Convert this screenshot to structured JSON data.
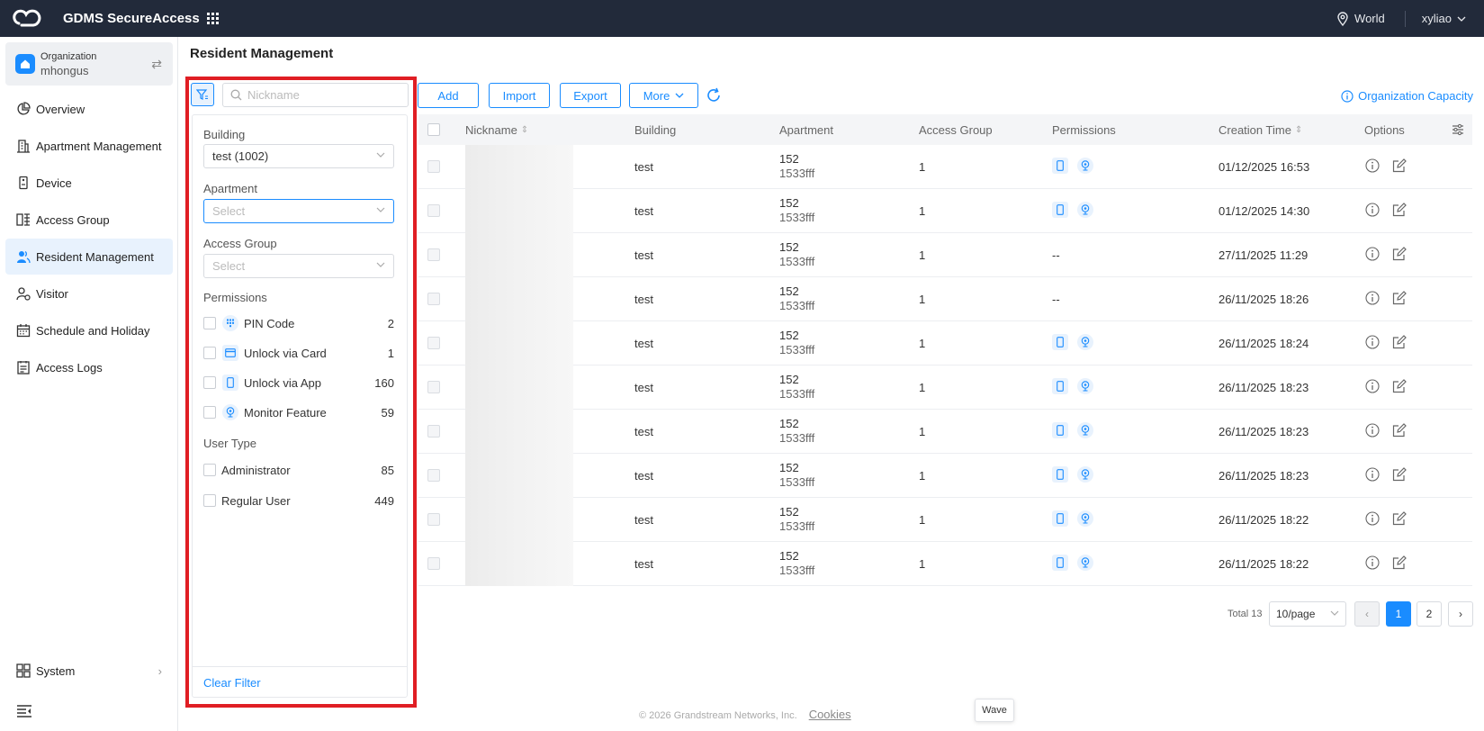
{
  "topbar": {
    "app_title": "GDMS SecureAccess",
    "region": "World",
    "username": "xyliao"
  },
  "sidebar": {
    "org_label": "Organization",
    "org_name": "mhongus",
    "items": [
      {
        "label": "Overview",
        "icon": "pie-chart-icon"
      },
      {
        "label": "Apartment Management",
        "icon": "building-icon"
      },
      {
        "label": "Device",
        "icon": "device-icon"
      },
      {
        "label": "Access Group",
        "icon": "access-group-icon"
      },
      {
        "label": "Resident Management",
        "icon": "users-icon",
        "active": true
      },
      {
        "label": "Visitor",
        "icon": "visitor-icon"
      },
      {
        "label": "Schedule and Holiday",
        "icon": "calendar-icon"
      },
      {
        "label": "Access Logs",
        "icon": "logs-icon"
      }
    ],
    "system_label": "System"
  },
  "page_title": "Resident Management",
  "search": {
    "placeholder": "Nickname"
  },
  "toolbar": {
    "add_label": "Add",
    "import_label": "Import",
    "export_label": "Export",
    "more_label": "More",
    "capacity_label": "Organization Capacity"
  },
  "filter": {
    "building_label": "Building",
    "building_value": "test (1002)",
    "apartment_label": "Apartment",
    "apartment_placeholder": "Select",
    "access_group_label": "Access Group",
    "access_group_placeholder": "Select",
    "permissions_label": "Permissions",
    "permissions": [
      {
        "label": "PIN Code",
        "count": "2",
        "icon": "pin-code-icon"
      },
      {
        "label": "Unlock via Card",
        "count": "1",
        "icon": "card-icon"
      },
      {
        "label": "Unlock via App",
        "count": "160",
        "icon": "phone-icon"
      },
      {
        "label": "Monitor Feature",
        "count": "59",
        "icon": "camera-icon"
      }
    ],
    "user_type_label": "User Type",
    "user_types": [
      {
        "label": "Administrator",
        "count": "85"
      },
      {
        "label": "Regular User",
        "count": "449"
      }
    ],
    "clear_label": "Clear Filter"
  },
  "table": {
    "columns": [
      "Nickname",
      "Building",
      "Apartment",
      "Access Group",
      "Permissions",
      "Creation Time",
      "Options"
    ],
    "rows": [
      {
        "building": "test",
        "apt_a": "152",
        "apt_b": "1533fff",
        "group": "1",
        "perms": true,
        "time": "01/12/2025 16:53"
      },
      {
        "building": "test",
        "apt_a": "152",
        "apt_b": "1533fff",
        "group": "1",
        "perms": true,
        "time": "01/12/2025 14:30"
      },
      {
        "building": "test",
        "apt_a": "152",
        "apt_b": "1533fff",
        "group": "1",
        "perms": false,
        "perm_text": "--",
        "time": "27/11/2025 11:29"
      },
      {
        "building": "test",
        "apt_a": "152",
        "apt_b": "1533fff",
        "group": "1",
        "perms": false,
        "perm_text": "--",
        "time": "26/11/2025 18:26"
      },
      {
        "building": "test",
        "apt_a": "152",
        "apt_b": "1533fff",
        "group": "1",
        "perms": true,
        "time": "26/11/2025 18:24"
      },
      {
        "building": "test",
        "apt_a": "152",
        "apt_b": "1533fff",
        "group": "1",
        "perms": true,
        "time": "26/11/2025 18:23"
      },
      {
        "building": "test",
        "apt_a": "152",
        "apt_b": "1533fff",
        "group": "1",
        "perms": true,
        "time": "26/11/2025 18:23"
      },
      {
        "building": "test",
        "apt_a": "152",
        "apt_b": "1533fff",
        "group": "1",
        "perms": true,
        "time": "26/11/2025 18:23"
      },
      {
        "building": "test",
        "apt_a": "152",
        "apt_b": "1533fff",
        "group": "1",
        "perms": true,
        "time": "26/11/2025 18:22"
      },
      {
        "building": "test",
        "apt_a": "152",
        "apt_b": "1533fff",
        "group": "1",
        "perms": true,
        "time": "26/11/2025 18:22"
      }
    ]
  },
  "pagination": {
    "total": "Total 13",
    "page_size": "10/page",
    "pages": [
      "1",
      "2"
    ],
    "current": "1"
  },
  "footer": {
    "copyright": "© 2026 Grandstream Networks, Inc.",
    "cookies": "Cookies"
  },
  "tooltip": "Wave",
  "colors": {
    "accent": "#1a8cff",
    "topbar": "#222a3a",
    "highlight": "#e01e24"
  }
}
